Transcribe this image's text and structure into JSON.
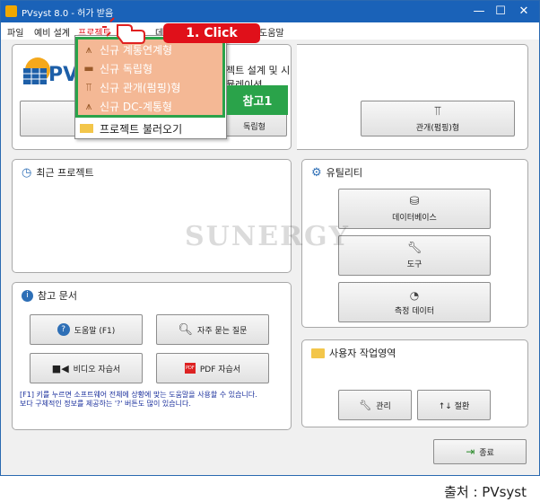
{
  "window": {
    "title": "PVsyst 8.0 - 허가 받음",
    "minimize": "—",
    "maximize": "☐",
    "close": "✕"
  },
  "menu": [
    "파일",
    "예비 설계",
    "프로젝트",
    "데",
    "도움말"
  ],
  "dropdown": {
    "items": [
      "신규 계통연계형",
      "신규 독립형",
      "신규 관개(펌핑)형",
      "신규 DC-계통형"
    ],
    "load": "프로젝트 불러오기"
  },
  "annotations": {
    "click": "1. Click",
    "ref": "참고1"
  },
  "top_panel": {
    "logo_text": "PV",
    "heading": "젝트 설계 및 시뮬레이션",
    "btn_standalone": "독립형",
    "btn_pumping": "관개(펌핑)형"
  },
  "recent": {
    "title": "최근 프로젝트"
  },
  "utility": {
    "title": "유틸리티",
    "database": "데이터베이스",
    "tools": "도구",
    "measured": "측정 데이터"
  },
  "reference": {
    "title": "참고 문서",
    "help": "도움말 (F1)",
    "faq": "자주 묻는 질문",
    "video": "비디오 자습서",
    "pdf": "PDF 자습서",
    "note": "[F1] 키를 누르면 소프트웨어 전체에 상황에 맞는 도움말을 사용할 수 있습니다.\n보다 구체적인 정보를 제공하는 '?' 버튼도 많이 있습니다."
  },
  "workspace": {
    "title": "사용자 작업영역",
    "manage": "관리",
    "toggle": "↑↓ 절환"
  },
  "exit": "종료",
  "watermark": "SUNERGY",
  "caption": "출처 : PVsyst"
}
